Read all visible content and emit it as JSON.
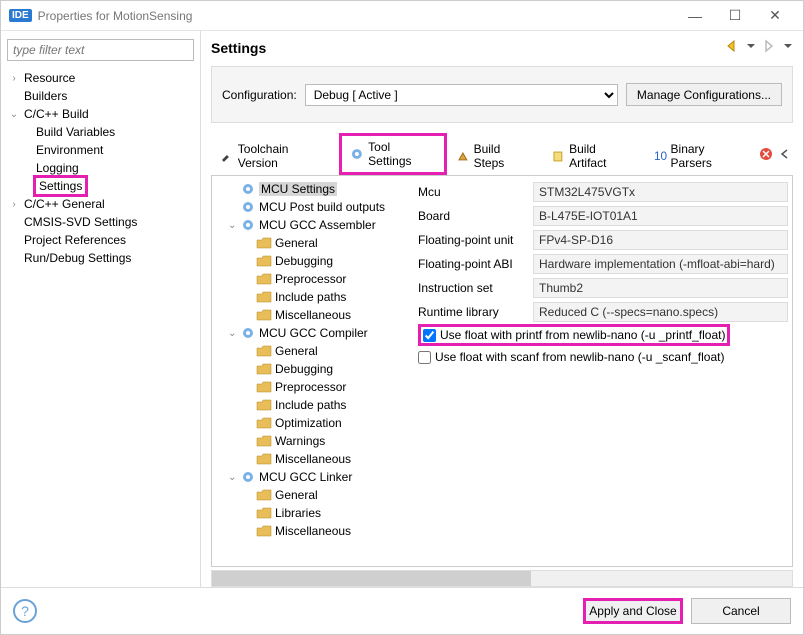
{
  "window": {
    "title": "Properties for MotionSensing"
  },
  "filter_placeholder": "type filter text",
  "left_nav": {
    "items": [
      {
        "label": "Resource",
        "expandable": true
      },
      {
        "label": "Builders"
      },
      {
        "label": "C/C++ Build",
        "expandable": true,
        "expanded": true,
        "children": [
          {
            "label": "Build Variables"
          },
          {
            "label": "Environment"
          },
          {
            "label": "Logging"
          },
          {
            "label": "Settings",
            "highlighted": true
          }
        ]
      },
      {
        "label": "C/C++ General",
        "expandable": true
      },
      {
        "label": "CMSIS-SVD Settings"
      },
      {
        "label": "Project References"
      },
      {
        "label": "Run/Debug Settings"
      }
    ]
  },
  "header": {
    "title": "Settings"
  },
  "config_bar": {
    "label": "Configuration:",
    "selected": "Debug  [ Active ]",
    "manage_button": "Manage Configurations..."
  },
  "tabs": {
    "items": [
      {
        "label": "Toolchain Version"
      },
      {
        "label": "Tool Settings",
        "selected": true,
        "highlighted": true
      },
      {
        "label": "Build Steps"
      },
      {
        "label": "Build Artifact"
      },
      {
        "label": "Binary Parsers"
      }
    ]
  },
  "tree": {
    "items": [
      {
        "label": "MCU Settings",
        "icon": "gear",
        "selected": true
      },
      {
        "label": "MCU Post build outputs",
        "icon": "gear"
      },
      {
        "label": "MCU GCC Assembler",
        "icon": "gear",
        "expanded": true,
        "children": [
          {
            "label": "General",
            "icon": "folder"
          },
          {
            "label": "Debugging",
            "icon": "folder"
          },
          {
            "label": "Preprocessor",
            "icon": "folder"
          },
          {
            "label": "Include paths",
            "icon": "folder"
          },
          {
            "label": "Miscellaneous",
            "icon": "folder"
          }
        ]
      },
      {
        "label": "MCU GCC Compiler",
        "icon": "gear",
        "expanded": true,
        "children": [
          {
            "label": "General",
            "icon": "folder"
          },
          {
            "label": "Debugging",
            "icon": "folder"
          },
          {
            "label": "Preprocessor",
            "icon": "folder"
          },
          {
            "label": "Include paths",
            "icon": "folder"
          },
          {
            "label": "Optimization",
            "icon": "folder"
          },
          {
            "label": "Warnings",
            "icon": "folder"
          },
          {
            "label": "Miscellaneous",
            "icon": "folder"
          }
        ]
      },
      {
        "label": "MCU GCC Linker",
        "icon": "gear",
        "expanded": true,
        "children": [
          {
            "label": "General",
            "icon": "folder"
          },
          {
            "label": "Libraries",
            "icon": "folder"
          },
          {
            "label": "Miscellaneous",
            "icon": "folder"
          }
        ]
      }
    ]
  },
  "props": {
    "rows": [
      {
        "label": "Mcu",
        "value": "STM32L475VGTx"
      },
      {
        "label": "Board",
        "value": "B-L475E-IOT01A1"
      },
      {
        "label": "Floating-point unit",
        "value": "FPv4-SP-D16"
      },
      {
        "label": "Floating-point ABI",
        "value": "Hardware implementation (-mfloat-abi=hard)"
      },
      {
        "label": "Instruction set",
        "value": "Thumb2"
      },
      {
        "label": "Runtime library",
        "value": "Reduced C (--specs=nano.specs)"
      }
    ],
    "checks": [
      {
        "label": "Use float with printf from newlib-nano (-u _printf_float)",
        "checked": true,
        "highlighted": true
      },
      {
        "label": "Use float with scanf from newlib-nano (-u _scanf_float)",
        "checked": false
      }
    ]
  },
  "footer": {
    "apply_close": "Apply and Close",
    "cancel": "Cancel"
  }
}
